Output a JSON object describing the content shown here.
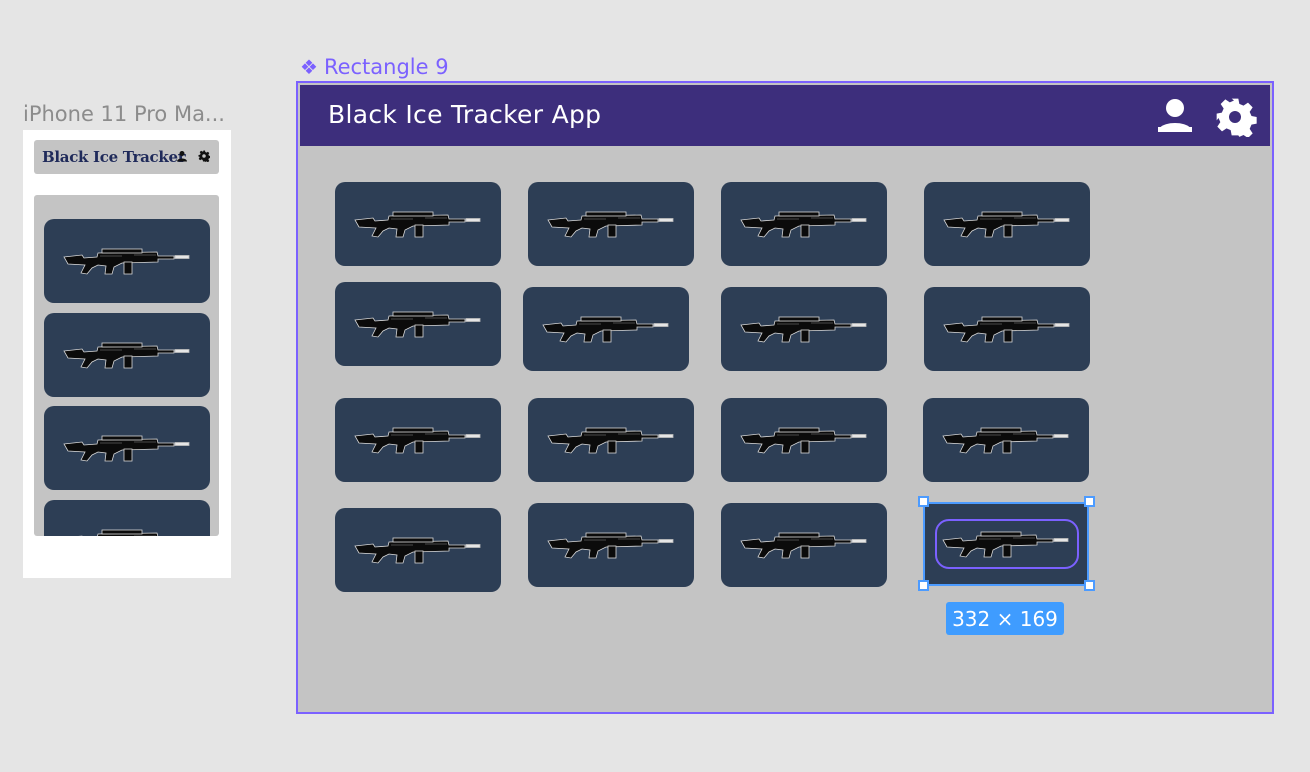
{
  "canvas": {
    "phone_frame_label": "iPhone 11 Pro Ma...",
    "component_label": "Rectangle 9",
    "component_icon": "component-diamond-icon"
  },
  "phone": {
    "title": "Black Ice Tracker",
    "icons": [
      "user-icon",
      "gear-icon"
    ],
    "card_count": 4,
    "card_image": "rifle-icon"
  },
  "app": {
    "title": "Black Ice Tracker App",
    "icons": [
      "user-icon",
      "gear-icon"
    ],
    "card_image": "rifle-icon",
    "colors": {
      "header": "#3d2e7c",
      "body": "#c4c4c4",
      "card": "#2d3e55",
      "selection": "#4c9bff",
      "component": "#7b61ff"
    }
  },
  "selection": {
    "dimensions": "332 × 169"
  }
}
